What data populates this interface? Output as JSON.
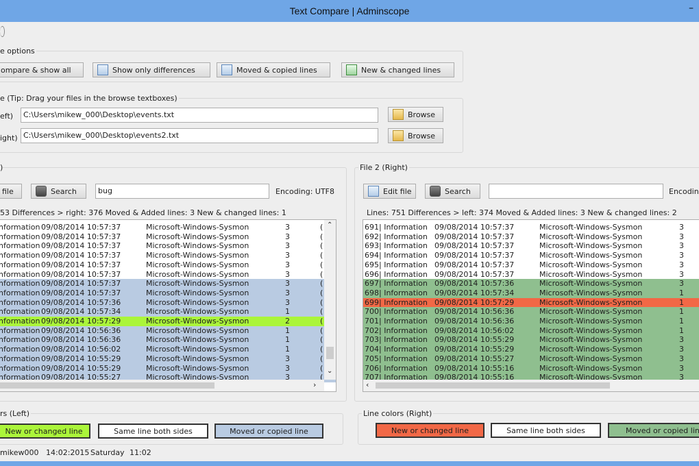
{
  "window": {
    "title": "Text Compare | Adminscope",
    "minimize_glyph": "–"
  },
  "colors": {
    "titlebar": "#6fa6e6",
    "moved": "#b9cbe2",
    "new_left": "#abf53a",
    "new_right": "#f26846",
    "moved_right": "#8fbf8f"
  },
  "compare_options": {
    "label": "e options",
    "buttons": [
      {
        "label": "ompare & show all",
        "icon": "compare-icon"
      },
      {
        "label": "Show only differences",
        "icon": "differences-icon"
      },
      {
        "label": "Moved & copied lines",
        "icon": "moved-lines-icon"
      },
      {
        "label": "New & changed lines",
        "icon": "new-lines-icon"
      }
    ]
  },
  "files": {
    "label": "e (Tip: Drag your files in the browse textboxes)",
    "left_label": "eft)",
    "right_label": "ight)",
    "left_path": "C:\\Users\\mikew_000\\Desktop\\events.txt",
    "right_path": "C:\\Users\\mikew_000\\Desktop\\events2.txt",
    "browse_label": "Browse"
  },
  "left": {
    "title": ")",
    "edit_label": "file",
    "search_label": "Search",
    "search_value": "bug",
    "encoding": "Encoding: UTF8",
    "stats": "53   Differences > right: 376   Moved & Added lines: 3   New & changed lines: 1",
    "rows": [
      {
        "c1": "nformation",
        "c2": "09/08/2014 10:57:37",
        "c3": "Microsoft-Windows-Sysmon",
        "c4": "3",
        "c5": "(",
        "hl": ""
      },
      {
        "c1": "nformation",
        "c2": "09/08/2014 10:57:37",
        "c3": "Microsoft-Windows-Sysmon",
        "c4": "3",
        "c5": "(",
        "hl": ""
      },
      {
        "c1": "nformation",
        "c2": "09/08/2014 10:57:37",
        "c3": "Microsoft-Windows-Sysmon",
        "c4": "3",
        "c5": "(",
        "hl": ""
      },
      {
        "c1": "nformation",
        "c2": "09/08/2014 10:57:37",
        "c3": "Microsoft-Windows-Sysmon",
        "c4": "3",
        "c5": "(",
        "hl": ""
      },
      {
        "c1": "nformation",
        "c2": "09/08/2014 10:57:37",
        "c3": "Microsoft-Windows-Sysmon",
        "c4": "3",
        "c5": "(",
        "hl": ""
      },
      {
        "c1": "nformation",
        "c2": "09/08/2014 10:57:37",
        "c3": "Microsoft-Windows-Sysmon",
        "c4": "3",
        "c5": "(",
        "hl": ""
      },
      {
        "c1": "nformation",
        "c2": "09/08/2014 10:57:37",
        "c3": "Microsoft-Windows-Sysmon",
        "c4": "3",
        "c5": "(",
        "hl": "blue"
      },
      {
        "c1": "nformation",
        "c2": "09/08/2014 10:57:37",
        "c3": "Microsoft-Windows-Sysmon",
        "c4": "3",
        "c5": "(",
        "hl": "blue"
      },
      {
        "c1": "nformation",
        "c2": "09/08/2014 10:57:36",
        "c3": "Microsoft-Windows-Sysmon",
        "c4": "3",
        "c5": "(",
        "hl": "blue"
      },
      {
        "c1": "nformation",
        "c2": "09/08/2014 10:57:34",
        "c3": "Microsoft-Windows-Sysmon",
        "c4": "1",
        "c5": "(",
        "hl": "blue"
      },
      {
        "c1": "nformation",
        "c2": "09/08/2014 10:57:29",
        "c3": "Microsoft-Windows-Sysmon",
        "c4": "2",
        "c5": "(",
        "hl": "lime"
      },
      {
        "c1": "nformation",
        "c2": "09/08/2014 10:56:36",
        "c3": "Microsoft-Windows-Sysmon",
        "c4": "1",
        "c5": "(",
        "hl": "blue"
      },
      {
        "c1": "nformation",
        "c2": "09/08/2014 10:56:36",
        "c3": "Microsoft-Windows-Sysmon",
        "c4": "1",
        "c5": "(",
        "hl": "blue"
      },
      {
        "c1": "nformation",
        "c2": "09/08/2014 10:56:02",
        "c3": "Microsoft-Windows-Sysmon",
        "c4": "1",
        "c5": "(",
        "hl": "blue"
      },
      {
        "c1": "nformation",
        "c2": "09/08/2014 10:55:29",
        "c3": "Microsoft-Windows-Sysmon",
        "c4": "3",
        "c5": "(",
        "hl": "blue"
      },
      {
        "c1": "nformation",
        "c2": "09/08/2014 10:55:29",
        "c3": "Microsoft-Windows-Sysmon",
        "c4": "3",
        "c5": "(",
        "hl": "blue"
      },
      {
        "c1": "nformation",
        "c2": "09/08/2014 10:55:27",
        "c3": "Microsoft-Windows-Sysmon",
        "c4": "3",
        "c5": "(",
        "hl": "blue"
      }
    ]
  },
  "right": {
    "title": "File 2 (Right)",
    "edit_label": "Edit file",
    "search_label": "Search",
    "search_value": "",
    "encoding": "Encoding",
    "stats": "Lines: 751   Differences > left: 374   Moved & Added lines: 3   New & changed lines: 2",
    "rows": [
      {
        "c1": "691| Information",
        "c2": "09/08/2014 10:57:37",
        "c3": "Microsoft-Windows-Sysmon",
        "c4": "3",
        "hl": ""
      },
      {
        "c1": "692| Information",
        "c2": "09/08/2014 10:57:37",
        "c3": "Microsoft-Windows-Sysmon",
        "c4": "3",
        "hl": ""
      },
      {
        "c1": "693| Information",
        "c2": "09/08/2014 10:57:37",
        "c3": "Microsoft-Windows-Sysmon",
        "c4": "3",
        "hl": ""
      },
      {
        "c1": "694| Information",
        "c2": "09/08/2014 10:57:37",
        "c3": "Microsoft-Windows-Sysmon",
        "c4": "3",
        "hl": ""
      },
      {
        "c1": "695| Information",
        "c2": "09/08/2014 10:57:37",
        "c3": "Microsoft-Windows-Sysmon",
        "c4": "3",
        "hl": ""
      },
      {
        "c1": "696| Information",
        "c2": "09/08/2014 10:57:37",
        "c3": "Microsoft-Windows-Sysmon",
        "c4": "3",
        "hl": ""
      },
      {
        "c1": "697| Information",
        "c2": "09/08/2014 10:57:36",
        "c3": "Microsoft-Windows-Sysmon",
        "c4": "3",
        "hl": "green"
      },
      {
        "c1": "698| Information",
        "c2": "09/08/2014 10:57:34",
        "c3": "Microsoft-Windows-Sysmon",
        "c4": "1",
        "hl": "green"
      },
      {
        "c1": "699| Information",
        "c2": "09/08/2014 10:57:29",
        "c3": "Microsoft-Windows-Sysmon",
        "c4": "1",
        "hl": "red"
      },
      {
        "c1": "700| Information",
        "c2": "09/08/2014 10:56:36",
        "c3": "Microsoft-Windows-Sysmon",
        "c4": "1",
        "hl": "green"
      },
      {
        "c1": "701| Information",
        "c2": "09/08/2014 10:56:36",
        "c3": "Microsoft-Windows-Sysmon",
        "c4": "1",
        "hl": "green"
      },
      {
        "c1": "702| Information",
        "c2": "09/08/2014 10:56:02",
        "c3": "Microsoft-Windows-Sysmon",
        "c4": "1",
        "hl": "green"
      },
      {
        "c1": "703| Information",
        "c2": "09/08/2014 10:55:29",
        "c3": "Microsoft-Windows-Sysmon",
        "c4": "3",
        "hl": "green"
      },
      {
        "c1": "704| Information",
        "c2": "09/08/2014 10:55:29",
        "c3": "Microsoft-Windows-Sysmon",
        "c4": "3",
        "hl": "green"
      },
      {
        "c1": "705| Information",
        "c2": "09/08/2014 10:55:27",
        "c3": "Microsoft-Windows-Sysmon",
        "c4": "3",
        "hl": "green"
      },
      {
        "c1": "706| Information",
        "c2": "09/08/2014 10:55:16",
        "c3": "Microsoft-Windows-Sysmon",
        "c4": "3",
        "hl": "green"
      },
      {
        "c1": "707| Information",
        "c2": "09/08/2014 10:55:16",
        "c3": "Microsoft-Windows-Sysmon",
        "c4": "3",
        "hl": "green"
      }
    ]
  },
  "legend_left": {
    "title": "rs (Left)",
    "new": "New or changed line",
    "same": "Same line both sides",
    "moved": "Moved or copied line"
  },
  "legend_right": {
    "title": "Line colors (Right)",
    "new": "New or changed line",
    "same": "Same line both sides",
    "moved": "Moved or copied line"
  },
  "status": {
    "user": "mikew000",
    "time": "14:02:2015",
    "day": "Saturday",
    "clock": "11:02"
  }
}
